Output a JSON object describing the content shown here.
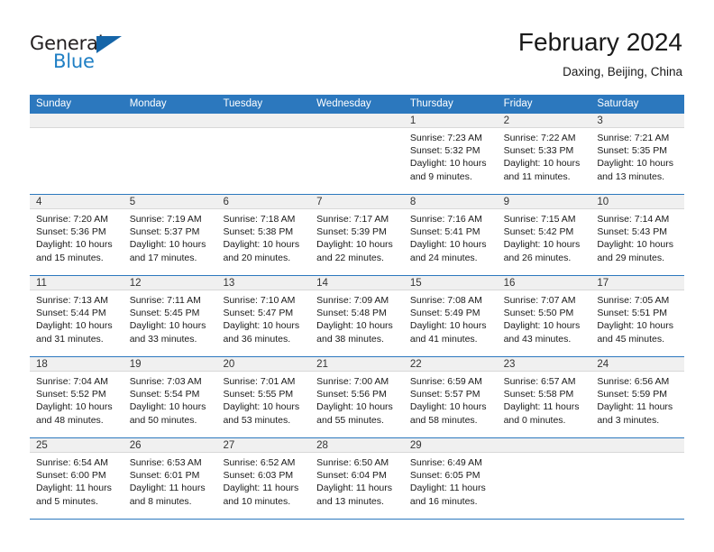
{
  "brand": {
    "name_part1": "General",
    "name_part2": "Blue",
    "accent_color": "#1f7fc4",
    "triangle_color": "#1565a8"
  },
  "header": {
    "month_title": "February 2024",
    "location": "Daxing, Beijing, China"
  },
  "theme": {
    "header_blue": "#2c78be",
    "daynum_strip": "#f0f0f0",
    "text": "#1a1a1a"
  },
  "weekday_headers": [
    "Sunday",
    "Monday",
    "Tuesday",
    "Wednesday",
    "Thursday",
    "Friday",
    "Saturday"
  ],
  "weeks": [
    [
      {
        "day": "",
        "sunrise": "",
        "sunset": "",
        "daylight_line1": "",
        "daylight_line2": ""
      },
      {
        "day": "",
        "sunrise": "",
        "sunset": "",
        "daylight_line1": "",
        "daylight_line2": ""
      },
      {
        "day": "",
        "sunrise": "",
        "sunset": "",
        "daylight_line1": "",
        "daylight_line2": ""
      },
      {
        "day": "",
        "sunrise": "",
        "sunset": "",
        "daylight_line1": "",
        "daylight_line2": ""
      },
      {
        "day": "1",
        "sunrise": "Sunrise: 7:23 AM",
        "sunset": "Sunset: 5:32 PM",
        "daylight_line1": "Daylight: 10 hours",
        "daylight_line2": "and 9 minutes."
      },
      {
        "day": "2",
        "sunrise": "Sunrise: 7:22 AM",
        "sunset": "Sunset: 5:33 PM",
        "daylight_line1": "Daylight: 10 hours",
        "daylight_line2": "and 11 minutes."
      },
      {
        "day": "3",
        "sunrise": "Sunrise: 7:21 AM",
        "sunset": "Sunset: 5:35 PM",
        "daylight_line1": "Daylight: 10 hours",
        "daylight_line2": "and 13 minutes."
      }
    ],
    [
      {
        "day": "4",
        "sunrise": "Sunrise: 7:20 AM",
        "sunset": "Sunset: 5:36 PM",
        "daylight_line1": "Daylight: 10 hours",
        "daylight_line2": "and 15 minutes."
      },
      {
        "day": "5",
        "sunrise": "Sunrise: 7:19 AM",
        "sunset": "Sunset: 5:37 PM",
        "daylight_line1": "Daylight: 10 hours",
        "daylight_line2": "and 17 minutes."
      },
      {
        "day": "6",
        "sunrise": "Sunrise: 7:18 AM",
        "sunset": "Sunset: 5:38 PM",
        "daylight_line1": "Daylight: 10 hours",
        "daylight_line2": "and 20 minutes."
      },
      {
        "day": "7",
        "sunrise": "Sunrise: 7:17 AM",
        "sunset": "Sunset: 5:39 PM",
        "daylight_line1": "Daylight: 10 hours",
        "daylight_line2": "and 22 minutes."
      },
      {
        "day": "8",
        "sunrise": "Sunrise: 7:16 AM",
        "sunset": "Sunset: 5:41 PM",
        "daylight_line1": "Daylight: 10 hours",
        "daylight_line2": "and 24 minutes."
      },
      {
        "day": "9",
        "sunrise": "Sunrise: 7:15 AM",
        "sunset": "Sunset: 5:42 PM",
        "daylight_line1": "Daylight: 10 hours",
        "daylight_line2": "and 26 minutes."
      },
      {
        "day": "10",
        "sunrise": "Sunrise: 7:14 AM",
        "sunset": "Sunset: 5:43 PM",
        "daylight_line1": "Daylight: 10 hours",
        "daylight_line2": "and 29 minutes."
      }
    ],
    [
      {
        "day": "11",
        "sunrise": "Sunrise: 7:13 AM",
        "sunset": "Sunset: 5:44 PM",
        "daylight_line1": "Daylight: 10 hours",
        "daylight_line2": "and 31 minutes."
      },
      {
        "day": "12",
        "sunrise": "Sunrise: 7:11 AM",
        "sunset": "Sunset: 5:45 PM",
        "daylight_line1": "Daylight: 10 hours",
        "daylight_line2": "and 33 minutes."
      },
      {
        "day": "13",
        "sunrise": "Sunrise: 7:10 AM",
        "sunset": "Sunset: 5:47 PM",
        "daylight_line1": "Daylight: 10 hours",
        "daylight_line2": "and 36 minutes."
      },
      {
        "day": "14",
        "sunrise": "Sunrise: 7:09 AM",
        "sunset": "Sunset: 5:48 PM",
        "daylight_line1": "Daylight: 10 hours",
        "daylight_line2": "and 38 minutes."
      },
      {
        "day": "15",
        "sunrise": "Sunrise: 7:08 AM",
        "sunset": "Sunset: 5:49 PM",
        "daylight_line1": "Daylight: 10 hours",
        "daylight_line2": "and 41 minutes."
      },
      {
        "day": "16",
        "sunrise": "Sunrise: 7:07 AM",
        "sunset": "Sunset: 5:50 PM",
        "daylight_line1": "Daylight: 10 hours",
        "daylight_line2": "and 43 minutes."
      },
      {
        "day": "17",
        "sunrise": "Sunrise: 7:05 AM",
        "sunset": "Sunset: 5:51 PM",
        "daylight_line1": "Daylight: 10 hours",
        "daylight_line2": "and 45 minutes."
      }
    ],
    [
      {
        "day": "18",
        "sunrise": "Sunrise: 7:04 AM",
        "sunset": "Sunset: 5:52 PM",
        "daylight_line1": "Daylight: 10 hours",
        "daylight_line2": "and 48 minutes."
      },
      {
        "day": "19",
        "sunrise": "Sunrise: 7:03 AM",
        "sunset": "Sunset: 5:54 PM",
        "daylight_line1": "Daylight: 10 hours",
        "daylight_line2": "and 50 minutes."
      },
      {
        "day": "20",
        "sunrise": "Sunrise: 7:01 AM",
        "sunset": "Sunset: 5:55 PM",
        "daylight_line1": "Daylight: 10 hours",
        "daylight_line2": "and 53 minutes."
      },
      {
        "day": "21",
        "sunrise": "Sunrise: 7:00 AM",
        "sunset": "Sunset: 5:56 PM",
        "daylight_line1": "Daylight: 10 hours",
        "daylight_line2": "and 55 minutes."
      },
      {
        "day": "22",
        "sunrise": "Sunrise: 6:59 AM",
        "sunset": "Sunset: 5:57 PM",
        "daylight_line1": "Daylight: 10 hours",
        "daylight_line2": "and 58 minutes."
      },
      {
        "day": "23",
        "sunrise": "Sunrise: 6:57 AM",
        "sunset": "Sunset: 5:58 PM",
        "daylight_line1": "Daylight: 11 hours",
        "daylight_line2": "and 0 minutes."
      },
      {
        "day": "24",
        "sunrise": "Sunrise: 6:56 AM",
        "sunset": "Sunset: 5:59 PM",
        "daylight_line1": "Daylight: 11 hours",
        "daylight_line2": "and 3 minutes."
      }
    ],
    [
      {
        "day": "25",
        "sunrise": "Sunrise: 6:54 AM",
        "sunset": "Sunset: 6:00 PM",
        "daylight_line1": "Daylight: 11 hours",
        "daylight_line2": "and 5 minutes."
      },
      {
        "day": "26",
        "sunrise": "Sunrise: 6:53 AM",
        "sunset": "Sunset: 6:01 PM",
        "daylight_line1": "Daylight: 11 hours",
        "daylight_line2": "and 8 minutes."
      },
      {
        "day": "27",
        "sunrise": "Sunrise: 6:52 AM",
        "sunset": "Sunset: 6:03 PM",
        "daylight_line1": "Daylight: 11 hours",
        "daylight_line2": "and 10 minutes."
      },
      {
        "day": "28",
        "sunrise": "Sunrise: 6:50 AM",
        "sunset": "Sunset: 6:04 PM",
        "daylight_line1": "Daylight: 11 hours",
        "daylight_line2": "and 13 minutes."
      },
      {
        "day": "29",
        "sunrise": "Sunrise: 6:49 AM",
        "sunset": "Sunset: 6:05 PM",
        "daylight_line1": "Daylight: 11 hours",
        "daylight_line2": "and 16 minutes."
      },
      {
        "day": "",
        "sunrise": "",
        "sunset": "",
        "daylight_line1": "",
        "daylight_line2": ""
      },
      {
        "day": "",
        "sunrise": "",
        "sunset": "",
        "daylight_line1": "",
        "daylight_line2": ""
      }
    ]
  ]
}
